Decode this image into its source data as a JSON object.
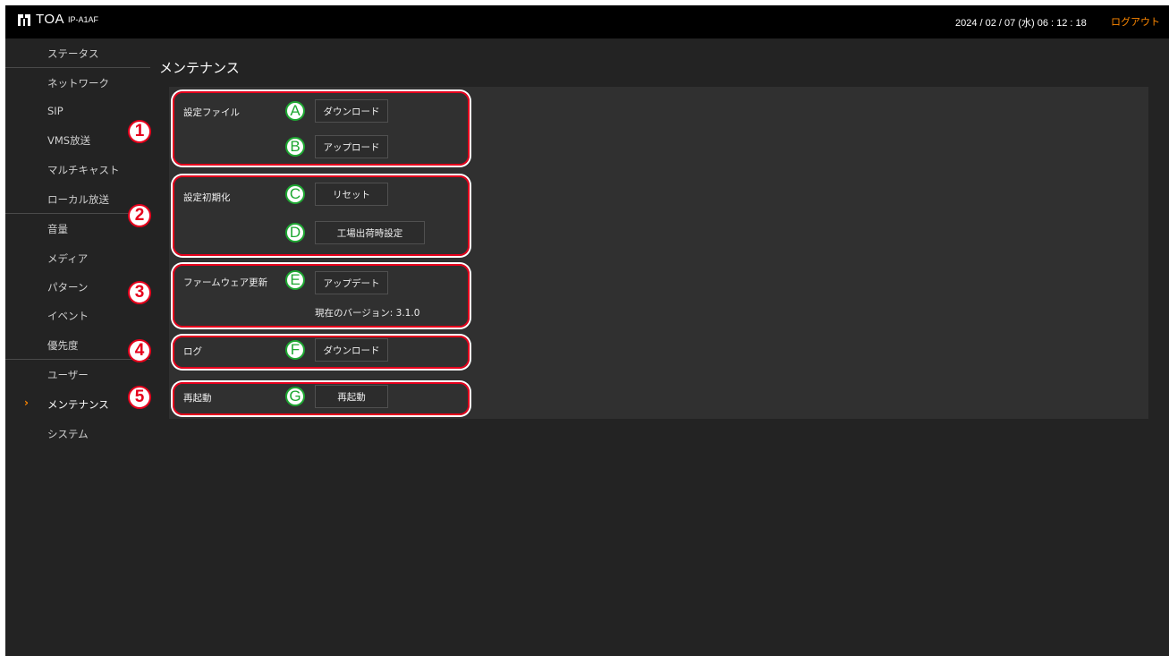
{
  "header": {
    "brand": "TOA",
    "model": "IP-A1AF",
    "datetime": "2024 / 02 / 07 (水)   06 : 12 : 18",
    "logout": "ログアウト",
    "logout_color": "#ff8800"
  },
  "sidebar": {
    "items": [
      {
        "label": "ステータス"
      },
      {
        "label": "ネットワーク"
      },
      {
        "label": "SIP"
      },
      {
        "label": "VMS放送"
      },
      {
        "label": "マルチキャスト"
      },
      {
        "label": "ローカル放送"
      },
      {
        "label": "音量"
      },
      {
        "label": "メディア"
      },
      {
        "label": "パターン"
      },
      {
        "label": "イベント"
      },
      {
        "label": "優先度"
      },
      {
        "label": "ユーザー"
      },
      {
        "label": "メンテナンス",
        "active": true
      },
      {
        "label": "システム"
      }
    ],
    "active_marker": "›"
  },
  "main": {
    "title": "メンテナンス",
    "sections": {
      "settings_file": {
        "label": "設定ファイル",
        "download": "ダウンロード",
        "upload": "アップロード"
      },
      "init": {
        "label": "設定初期化",
        "reset": "リセット",
        "factory": "工場出荷時設定"
      },
      "firmware": {
        "label": "ファームウェア更新",
        "update": "アップデート",
        "version": "現在のバージョン: 3.1.0"
      },
      "log": {
        "label": "ログ",
        "download": "ダウンロード"
      },
      "reboot": {
        "label": "再起動",
        "button": "再起動"
      }
    }
  },
  "annotations": {
    "numbers": [
      "1",
      "2",
      "3",
      "4",
      "5"
    ],
    "letters": [
      "A",
      "B",
      "C",
      "D",
      "E",
      "F",
      "G"
    ],
    "callout_color": "#e5001c",
    "letter_color": "#1ea832"
  }
}
